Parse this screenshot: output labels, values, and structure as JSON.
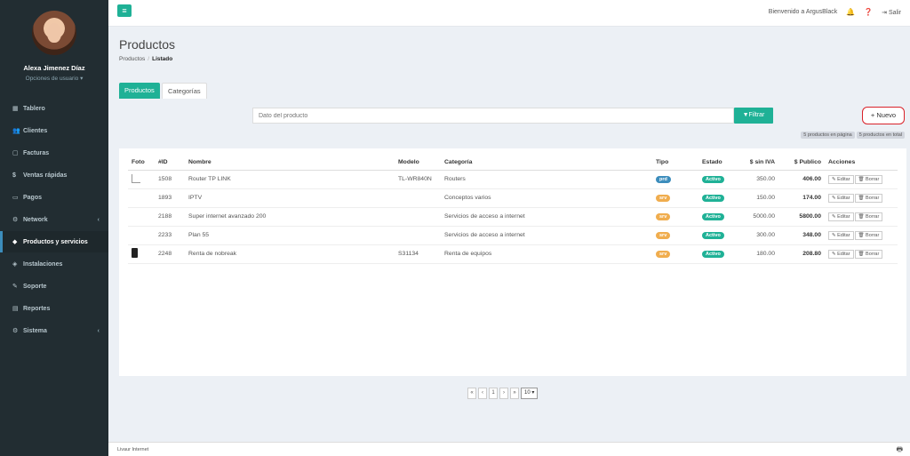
{
  "user": {
    "name": "Alexa Jimenez Díaz",
    "options": "Opciones de usuario ▾"
  },
  "sidebar": {
    "items": [
      {
        "icon": "▦",
        "label": "Tablero"
      },
      {
        "icon": "👥",
        "label": "Clientes"
      },
      {
        "icon": "▢",
        "label": "Facturas"
      },
      {
        "icon": "$",
        "label": "Ventas rápidas"
      },
      {
        "icon": "▭",
        "label": "Pagos"
      },
      {
        "icon": "⚙",
        "label": "Network"
      },
      {
        "icon": "◆",
        "label": "Productos y servicios"
      },
      {
        "icon": "◈",
        "label": "Instalaciones"
      },
      {
        "icon": "✎",
        "label": "Soporte"
      },
      {
        "icon": "▤",
        "label": "Reportes"
      },
      {
        "icon": "⚙",
        "label": "Sistema"
      }
    ]
  },
  "topbar": {
    "menu_icon": "≡",
    "welcome": "Bienvenido a ArgusBlack",
    "bell": "🔔",
    "help": "❓",
    "logout": "Salir"
  },
  "header": {
    "title": "Productos",
    "crumb_root": "Productos",
    "crumb_sep": "/",
    "crumb_current": "Listado"
  },
  "tabs": {
    "products": "Productos",
    "categories": "Categorías"
  },
  "filter": {
    "placeholder": "Dato del producto",
    "button": "▼Filtrar",
    "new_button": "+ Nuevo"
  },
  "counts": {
    "page": "5 productos en página",
    "total": "5 productos en total"
  },
  "table": {
    "headers": [
      "Foto",
      "#ID",
      "Nombre",
      "Modelo",
      "Categoría",
      "Tipo",
      "Estado",
      "$ sin IVA",
      "$ Publico",
      "Acciones"
    ],
    "rows": [
      {
        "id": "1508",
        "name": "Router TP LINK",
        "model": "TL-WR840N",
        "category": "Routers",
        "type": "prd",
        "status": "Activo",
        "net": "350.00",
        "public": "406.00"
      },
      {
        "id": "1893",
        "name": "IPTV",
        "model": "",
        "category": "Conceptos varios",
        "type": "srv",
        "status": "Activo",
        "net": "150.00",
        "public": "174.00"
      },
      {
        "id": "2188",
        "name": "Super internet avanzado 200",
        "model": "",
        "category": "Servicios de acceso a internet",
        "type": "srv",
        "status": "Activo",
        "net": "5000.00",
        "public": "5800.00"
      },
      {
        "id": "2233",
        "name": "Plan 55",
        "model": "",
        "category": "Servicios de acceso a internet",
        "type": "srv",
        "status": "Activo",
        "net": "300.00",
        "public": "348.00"
      },
      {
        "id": "2248",
        "name": "Renta de nobreak",
        "model": "S31134",
        "category": "Renta de equipos",
        "type": "srv",
        "status": "Activo",
        "net": "180.00",
        "public": "208.80"
      }
    ],
    "edit_label": "✎ Editar",
    "delete_label": "🗑 Borrar"
  },
  "pager": {
    "first": "«",
    "prev": "‹",
    "page": "1",
    "next": "›",
    "last": "»",
    "per_page": "10 ▾"
  },
  "footer": {
    "text": "Livaur Internet"
  },
  "colors": {
    "accent": "#1fb196",
    "prd": "#3c8dbc",
    "srv": "#f0ad4e",
    "active": "#1fb196"
  }
}
